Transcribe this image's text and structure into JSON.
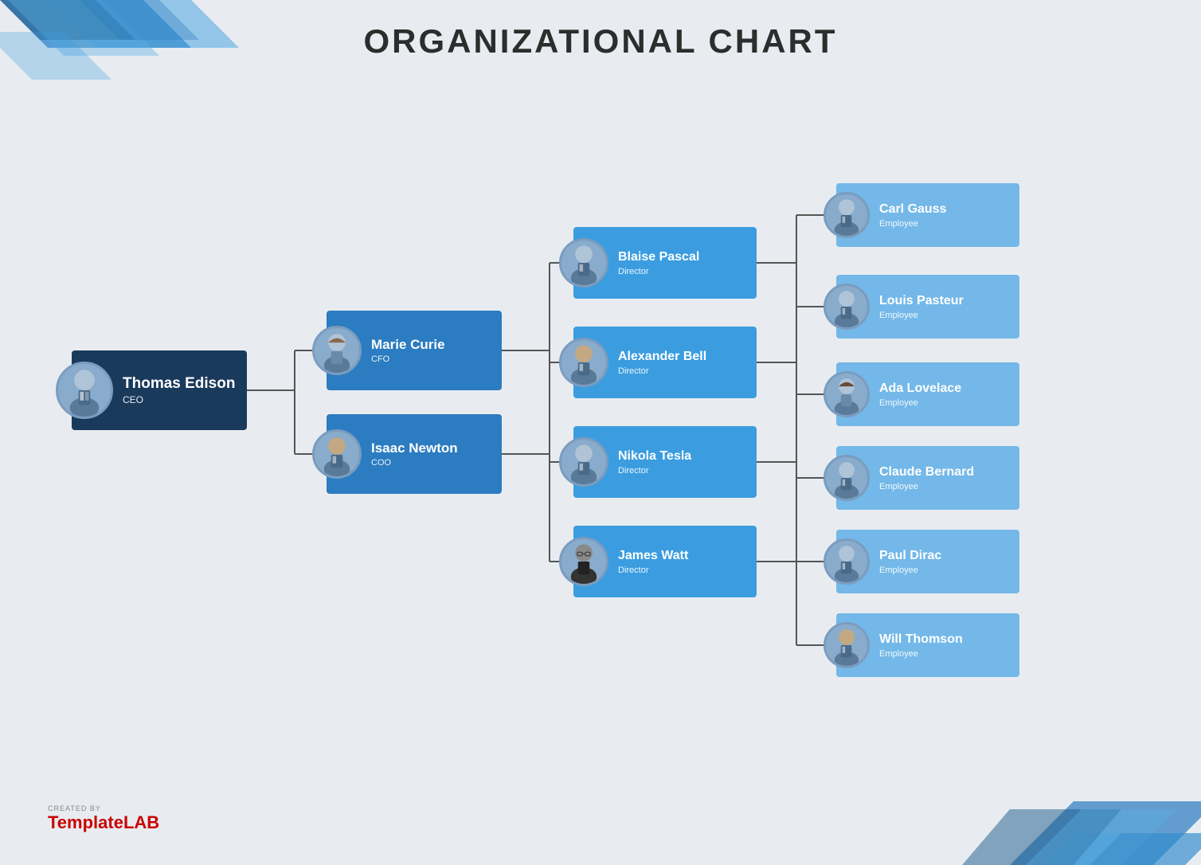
{
  "page": {
    "title": "ORGANIZATIONAL CHART",
    "background_color": "#e8ecf0"
  },
  "nodes": {
    "ceo": {
      "name": "Thomas Edison",
      "title": "CEO",
      "avatar_gender": "male"
    },
    "vp1": {
      "name": "Marie Curie",
      "title": "CFO",
      "avatar_gender": "female"
    },
    "vp2": {
      "name": "Isaac Newton",
      "title": "COO",
      "avatar_gender": "male_auburn"
    },
    "director1": {
      "name": "Blaise Pascal",
      "title": "Director",
      "avatar_gender": "male"
    },
    "director2": {
      "name": "Alexander Bell",
      "title": "Director",
      "avatar_gender": "male_brown"
    },
    "director3": {
      "name": "Nikola Tesla",
      "title": "Director",
      "avatar_gender": "male"
    },
    "director4": {
      "name": "James Watt",
      "title": "Director",
      "avatar_gender": "male_glasses"
    },
    "emp1": {
      "name": "Carl Gauss",
      "title": "Employee"
    },
    "emp2": {
      "name": "Louis Pasteur",
      "title": "Employee"
    },
    "emp3": {
      "name": "Ada Lovelace",
      "title": "Employee",
      "gender": "female"
    },
    "emp4": {
      "name": "Claude Bernard",
      "title": "Employee"
    },
    "emp5": {
      "name": "Paul Dirac",
      "title": "Employee"
    },
    "emp6": {
      "name": "Will Thomson",
      "title": "Employee"
    }
  },
  "footer": {
    "created_by": "CREATED BY",
    "brand_plain": "Template",
    "brand_bold": "LAB"
  },
  "colors": {
    "ceo_bg": "#1a3a5c",
    "vp_bg": "#2b7cc1",
    "director_bg": "#3b9de0",
    "employee_bg": "#73b8e8",
    "avatar_bg": "#8aaccc",
    "accent_blue": "#2b7cc1"
  }
}
